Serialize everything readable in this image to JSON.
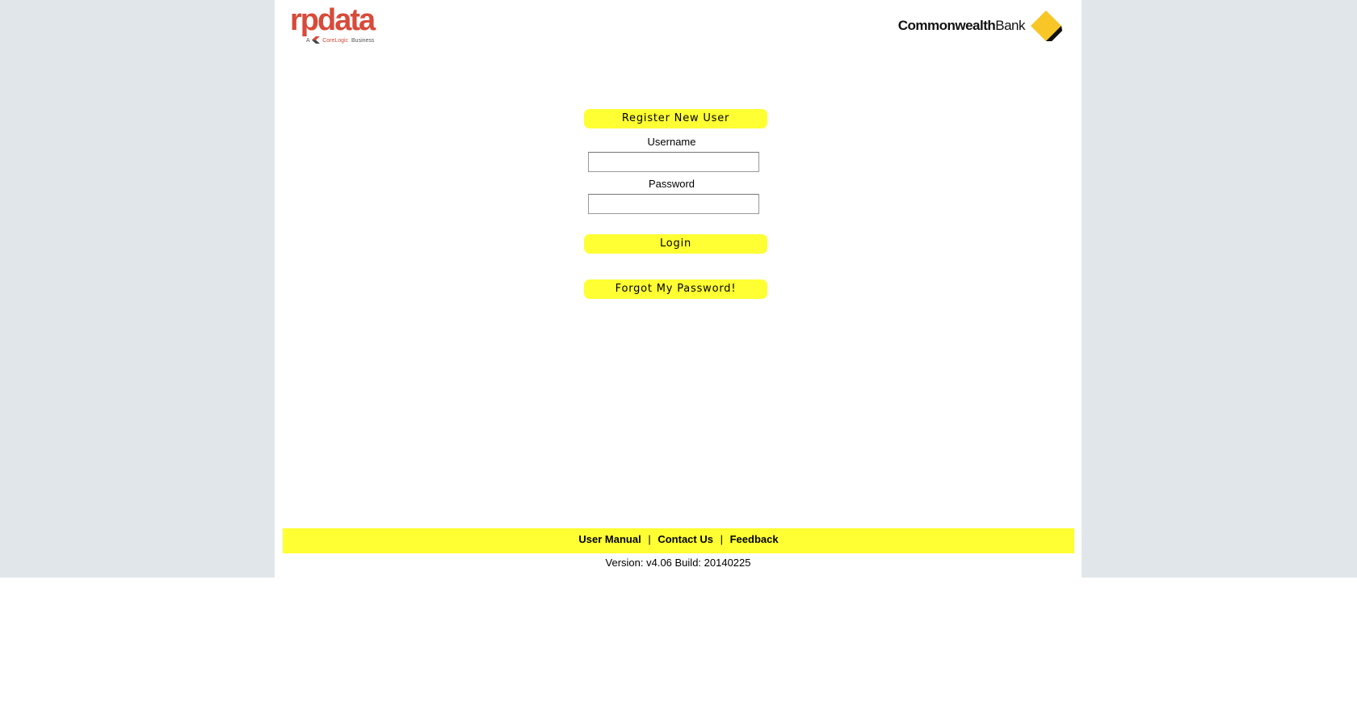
{
  "branding": {
    "rpdata_wordmark": "rpdata",
    "rpdata_tagline_prefix": "A",
    "rpdata_tagline_brand": "CoreLogic",
    "rpdata_tagline_suffix": "Business",
    "cba_name_bold": "Commonwealth",
    "cba_name_regular": "Bank",
    "cba_logo_icon": "cba-diamond-icon",
    "colors": {
      "rpdata_red": "#d84a3a",
      "cba_yellow": "#f8c626",
      "button_yellow": "#ffff33",
      "outer_background": "#e1e6ea"
    }
  },
  "form": {
    "register_label": "Register New User",
    "username_label": "Username",
    "username_value": "",
    "password_label": "Password",
    "password_value": "",
    "login_label": "Login",
    "forgot_label": "Forgot My Password!"
  },
  "footer": {
    "links": {
      "user_manual": "User Manual",
      "contact_us": "Contact Us",
      "feedback": "Feedback"
    },
    "separator": "|",
    "version": "Version: v4.06 Build: 20140225"
  }
}
